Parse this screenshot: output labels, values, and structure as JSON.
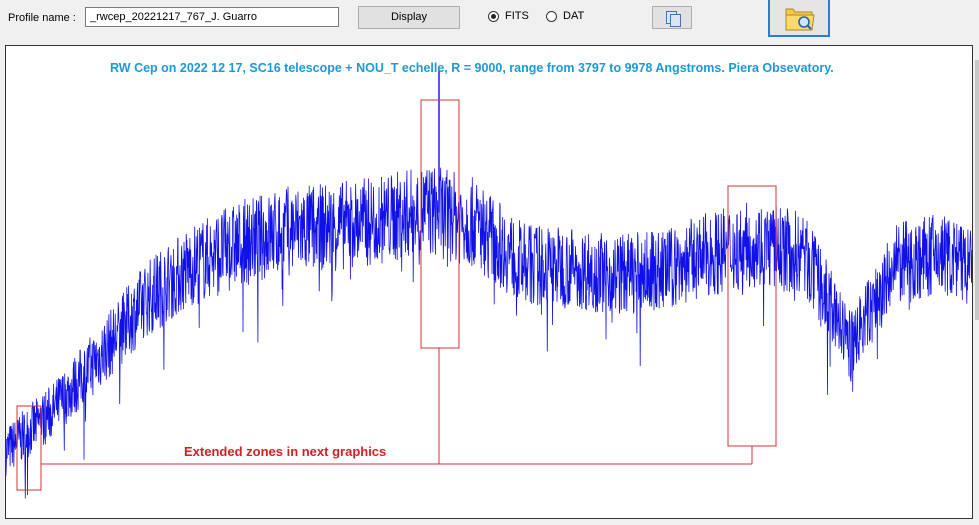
{
  "toolbar": {
    "profile_label": "Profile name :",
    "profile_value": "_rwcep_20221217_767_J. Guarro",
    "display_label": "Display",
    "radio_fits": "FITS",
    "radio_dat": "DAT",
    "selected_format": "FITS",
    "copy_icon": "copy-pages-icon",
    "open_icon": "folder-search-icon"
  },
  "plot": {
    "title": "RW Cep on 2022 12 17, SC16 telescope + NOU_T echelle, R = 9000, range from 3797 to 9978 Angstroms.     Piera Obsevatory.",
    "annotation": "Extended zones in next graphics",
    "colors": {
      "spectrum": "#1010e8",
      "title": "#1a9ad8",
      "annotation": "#d42020",
      "frame": "#d43030"
    }
  },
  "chart_data": {
    "type": "line",
    "title": "RW Cep on 2022 12 17, SC16 telescope + NOU_T echelle, R = 9000, range from 3797 to 9978 Angstroms.     Piera Obsevatory.",
    "xlabel": "",
    "ylabel": "",
    "xlim": [
      3797,
      9978
    ],
    "axes_visible": false,
    "grid": false,
    "continuum_x": [
      3797,
      4100,
      4400,
      4700,
      5000,
      5300,
      5600,
      5900,
      6200,
      6500,
      6800,
      7100,
      7400,
      7700,
      8000,
      8300,
      8600,
      8900,
      9200,
      9500,
      9800,
      9978
    ],
    "continuum_y": [
      0.05,
      0.17,
      0.33,
      0.5,
      0.6,
      0.66,
      0.7,
      0.71,
      0.73,
      0.76,
      0.72,
      0.6,
      0.59,
      0.57,
      0.58,
      0.63,
      0.66,
      0.63,
      0.36,
      0.6,
      0.63,
      0.58
    ],
    "zones": [
      {
        "x_range": [
          3797,
          3952
        ]
      },
      {
        "x_range": [
          6293,
          6526
        ]
      },
      {
        "x_range": [
          8138,
          8440
        ]
      }
    ]
  }
}
